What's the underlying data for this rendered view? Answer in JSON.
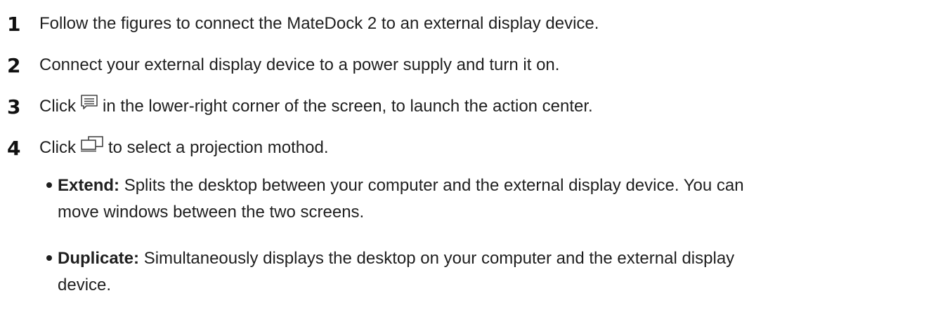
{
  "steps": [
    {
      "num": "1",
      "text": "Follow the figures to connect the MateDock 2 to an external display device."
    },
    {
      "num": "2",
      "text": "Connect your external display device to a power supply and turn it on."
    },
    {
      "num": "3",
      "text_before": "Click",
      "icon": "action-center-icon",
      "text_after": "in the lower-right corner of the screen, to launch the action center."
    },
    {
      "num": "4",
      "text_before": "Click",
      "icon": "project-icon",
      "text_after": "to select a projection mothod."
    }
  ],
  "bullets": [
    {
      "term": "Extend:",
      "line1": "Splits the desktop between your computer and the external display device. You can",
      "line2": "move windows between the two screens."
    },
    {
      "term": "Duplicate:",
      "line1": "Simultaneously displays the desktop on your computer and the external display",
      "line2": "device."
    }
  ]
}
